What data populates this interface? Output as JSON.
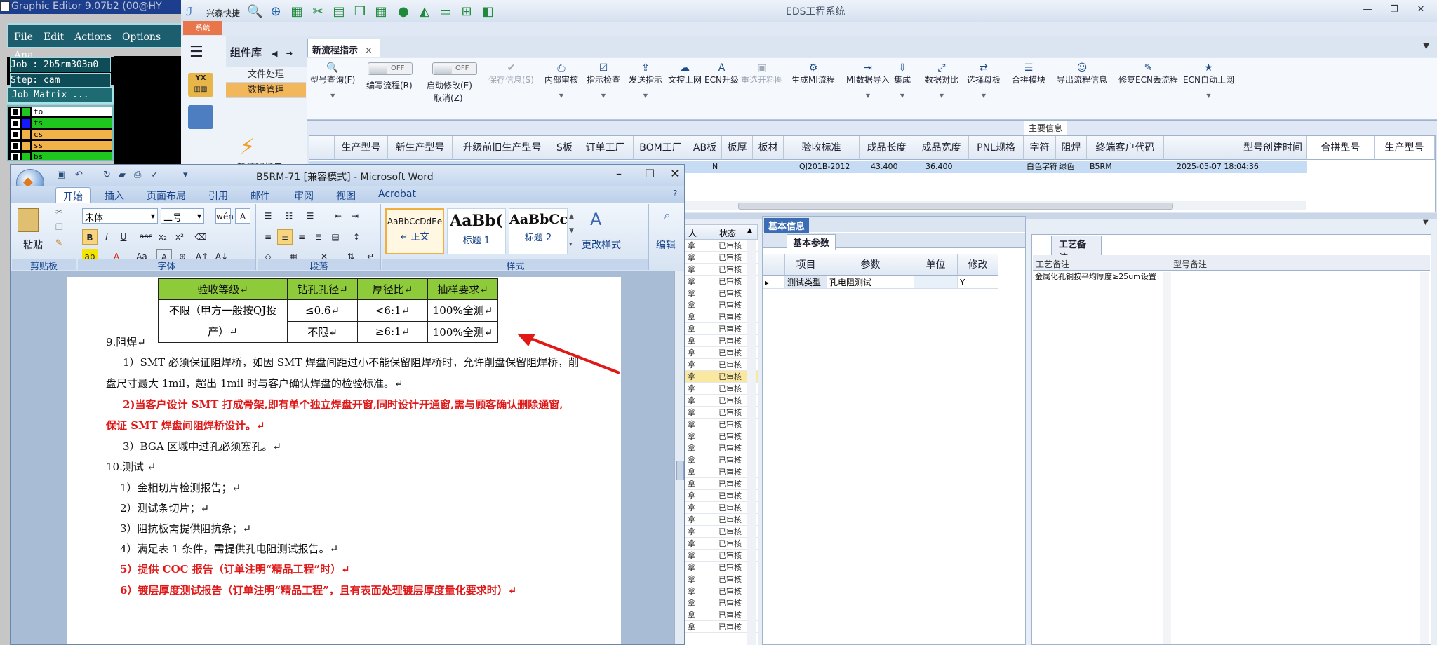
{
  "ge": {
    "title": "Graphic Editor 9.07b2 (00@HY",
    "menu": [
      "File",
      "Edit",
      "Actions",
      "Options",
      "Ana"
    ],
    "job": "Job : 2b5rm303a0",
    "step": "Step: cam",
    "job_matrix": "Job Matrix ...",
    "layers": [
      {
        "name": "to",
        "color": "#1ec61e"
      },
      {
        "name": "ts",
        "color": "#1818ff"
      },
      {
        "name": "cs",
        "color": "#f2b24a"
      },
      {
        "name": "ss",
        "color": "#f2b24a"
      },
      {
        "name": "bs",
        "color": "#1ec61e"
      }
    ]
  },
  "eds": {
    "title": "EDS工程系统",
    "quick_label": "兴森快捷",
    "system_tab": "系统",
    "library_title": "组件库",
    "library_menu": [
      "文件处理",
      "数据管理"
    ],
    "library_item": "新流程指示",
    "doc_tab": "新流程指示",
    "toolbar": {
      "query": "型号查询(F)",
      "write_flow": "编写流程(R)",
      "enable_modify": "启动修改(E)",
      "cancel": "取消(Z)",
      "save_info": "保存信息(S)",
      "internal_audit": "内部审核",
      "check_instruction": "指示检查",
      "send_instruction": "发送指示",
      "network_upload": "文控上网",
      "ecn_upgrade": "ECN升级",
      "reselect_drawing": "重选开料图",
      "generate_mi": "生成MI流程",
      "mi_import": "MI数据导入",
      "collect": "集成",
      "data_compare": "数据对比",
      "select_mother": "选择母板",
      "merge_module": "合拼模块",
      "export_flow": "导出流程信息",
      "fix_ecn": "修复ECN丢流程",
      "ecn_auto_upload": "ECN自动上网",
      "toggle_off": "OFF"
    },
    "main_info_label": "主要信息",
    "grid_headers": [
      "生产型号",
      "新生产型号",
      "升级前旧生产型号",
      "S板",
      "订单工厂",
      "BOM工厂",
      "AB板",
      "板厚",
      "板材",
      "验收标准",
      "成品长度",
      "成品宽度",
      "PNL规格",
      "字符",
      "阻焊",
      "终端客户代码",
      "型号创建时间",
      "合拼型号",
      "生产型号"
    ],
    "grid_row": {
      "col": "N",
      "standard": "QJ201B-2012",
      "length": "43.400",
      "width": "36.400",
      "char": "白色字符",
      "solder": "绿色",
      "customer": "B5RM",
      "created": "2025-05-07 18:04:36"
    },
    "status_cols": {
      "left": "人",
      "right": "状态"
    },
    "status_value": "已审核",
    "status_mark": "拿",
    "basic_tab": "基本信息",
    "basic_sub": "基本参数",
    "basic_headers": [
      "项目",
      "参数",
      "单位",
      "修改"
    ],
    "basic_row": {
      "item": "测试类型",
      "param": "孔电阻测试",
      "unit": "",
      "modify": "Y"
    },
    "process_tab": "工艺备注",
    "process_headers": [
      "工艺备注",
      "型号备注"
    ],
    "process_note": "金属化孔铜按平均厚度≥25um设置"
  },
  "word": {
    "title": "B5RM-71 [兼容模式] - Microsoft Word",
    "tabs": [
      "开始",
      "插入",
      "页面布局",
      "引用",
      "邮件",
      "审阅",
      "视图",
      "Acrobat"
    ],
    "font_name": "宋体",
    "font_size": "二号",
    "group_labels": [
      "剪贴板",
      "字体",
      "段落",
      "样式"
    ],
    "paste_label": "粘贴",
    "styles": [
      {
        "sample": "AaBbCcDdEe",
        "name": "↵ 正文"
      },
      {
        "sample": "AaBb(",
        "name": "标题 1"
      },
      {
        "sample": "AaBbCc",
        "name": "标题 2"
      }
    ],
    "change_style": "更改样式",
    "edit_label": "编辑",
    "table": {
      "headers": [
        "验收等级↵",
        "钻孔孔径↵",
        "厚径比↵",
        "抽样要求↵"
      ],
      "level": "不限（甲方一般按QJ投产）↵",
      "rows": [
        [
          "≤0.6↵",
          "<6:1↵",
          "100%全测↵"
        ],
        [
          "不限↵",
          "≥6:1↵",
          "100%全测↵"
        ]
      ]
    },
    "paragraphs": [
      {
        "text": "9.阻焊↵",
        "red": false,
        "indent": 0
      },
      {
        "text": "1）SMT 必须保证阻焊桥，如因 SMT 焊盘间距过小不能保留阻焊桥时，允许削盘保留阻焊桥，削",
        "red": false,
        "indent": 24
      },
      {
        "text": "盘尺寸最大 1mil，超出 1mil 时与客户确认焊盘的检验标准。↵",
        "red": false,
        "indent": 0
      },
      {
        "text": "2)当客户设计 SMT 打成骨架,即有单个独立焊盘开窗,同时设计开通窗,需与顾客确认删除通窗,",
        "red": true,
        "indent": 24
      },
      {
        "text": "保证 SMT 焊盘间阻焊桥设计。↵",
        "red": true,
        "indent": 0
      },
      {
        "text": "3）BGA 区域中过孔必须塞孔。↵",
        "red": false,
        "indent": 24
      },
      {
        "text": "10.测试 ↵",
        "red": false,
        "indent": 0
      },
      {
        "text": "1）金相切片检测报告；↵",
        "red": false,
        "indent": 20
      },
      {
        "text": "2）测试条切片；↵",
        "red": false,
        "indent": 20
      },
      {
        "text": "3）阻抗板需提供阻抗条；↵",
        "red": false,
        "indent": 20
      },
      {
        "text": "4）满足表 1 条件，需提供孔电阻测试报告。↵",
        "red": false,
        "indent": 20
      },
      {
        "text": "5）提供 COC 报告（订单注明“精品工程”时）↵",
        "red": true,
        "indent": 20
      },
      {
        "text": "6）镀层厚度测试报告（订单注明“精品工程”，且有表面处理镀层厚度量化要求时）↵",
        "red": true,
        "indent": 20
      }
    ]
  },
  "colors": {
    "annotation_arrow": "#e01818",
    "table_header": "#8ecb3a",
    "selected_row": "#c6dcf5",
    "tab_active": "#f2b75a"
  }
}
